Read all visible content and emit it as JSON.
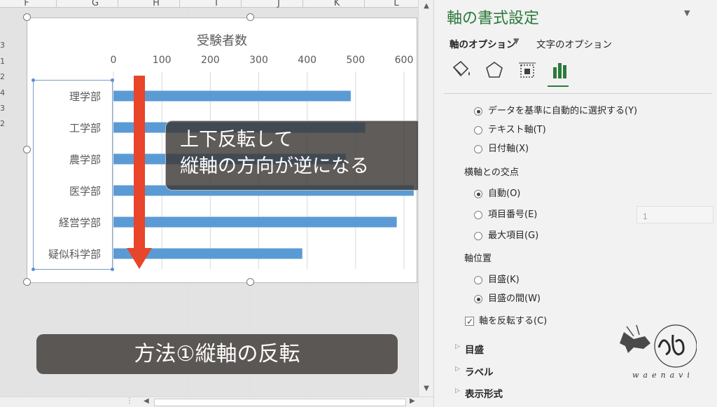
{
  "sheet": {
    "columns": [
      "F",
      "G",
      "H",
      "I",
      "J",
      "K",
      "L"
    ],
    "row_fragments": [
      "3",
      "1",
      "2",
      "4",
      "3",
      "2"
    ]
  },
  "chart_data": {
    "type": "bar",
    "title": "受験者数",
    "categories": [
      "理学部",
      "工学部",
      "農学部",
      "医学部",
      "経営学部",
      "疑似科学部"
    ],
    "values": [
      490,
      520,
      480,
      620,
      585,
      390
    ],
    "xticks": [
      "0",
      "100",
      "200",
      "300",
      "400",
      "500",
      "600"
    ],
    "xlim": [
      0,
      600
    ],
    "orientation": "horizontal",
    "grid": true,
    "bar_color": "#5b9bd5"
  },
  "overlay": {
    "line1": "上下反転して",
    "line2": "縦軸の方向が逆になる",
    "bottom": "方法①縦軸の反転"
  },
  "pane": {
    "title": "軸の書式設定",
    "tab_axis_options": "軸のオプション",
    "tab_text_options": "文字のオプション",
    "icons": [
      "paint-bucket-icon",
      "pentagon-icon",
      "size-properties-icon",
      "bar-chart-icon"
    ],
    "radios_axis_type": [
      {
        "label": "データを基準に自動的に選択する(Y)",
        "selected": true
      },
      {
        "label": "テキスト軸(T)",
        "selected": false
      },
      {
        "label": "日付軸(X)",
        "selected": false
      }
    ],
    "cross_section_label": "横軸との交点",
    "radios_cross": [
      {
        "label": "自動(O)",
        "selected": true
      },
      {
        "label": "項目番号(E)",
        "selected": false
      },
      {
        "label": "最大項目(G)",
        "selected": false
      }
    ],
    "cross_number_value": "1",
    "position_section_label": "軸位置",
    "radios_position": [
      {
        "label": "目盛(K)",
        "selected": false
      },
      {
        "label": "目盛の間(W)",
        "selected": true
      }
    ],
    "reverse_checkbox_label": "軸を反転する(C)",
    "reverse_checked": true,
    "collapsed_sections": [
      "目盛",
      "ラベル",
      "表示形式"
    ],
    "accent_color": "#2b7a3a"
  },
  "logo": {
    "text": "waenavi"
  }
}
